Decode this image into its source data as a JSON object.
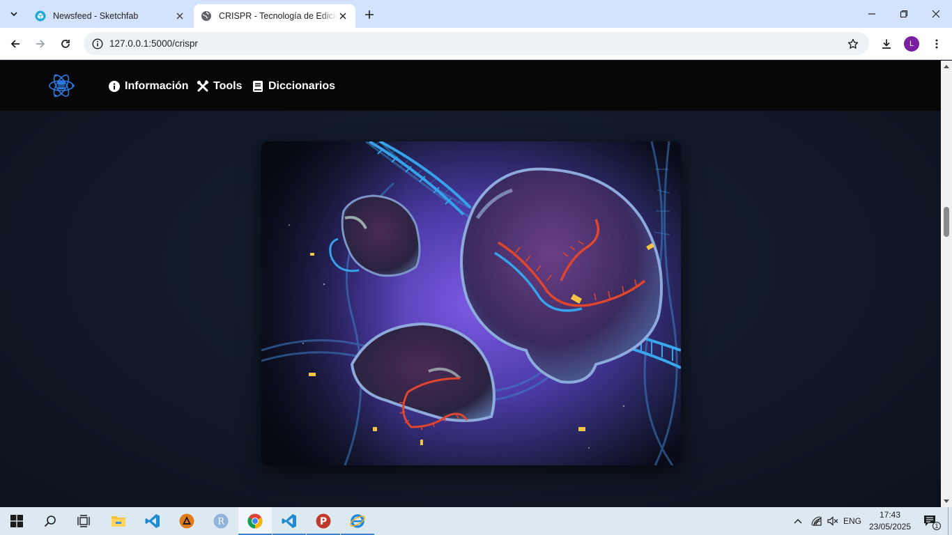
{
  "browser": {
    "tabs": [
      {
        "title": "Newsfeed - Sketchfab",
        "active": false
      },
      {
        "title": "CRISPR - Tecnología de Edición",
        "active": true
      }
    ],
    "url": "127.0.0.1:5000/crispr",
    "profile_initial": "L"
  },
  "site": {
    "nav": [
      {
        "label": "Información",
        "icon": "info-circle-icon"
      },
      {
        "label": "Tools",
        "icon": "tools-icon"
      },
      {
        "label": "Diccionarios",
        "icon": "book-icon"
      }
    ],
    "hero_image": "crispr-cas9-dna-illustration"
  },
  "taskbar": {
    "apps": [
      "start-icon",
      "search-icon",
      "task-view-icon",
      "file-explorer-icon",
      "vscode-icon",
      "app-triangle-icon",
      "r-icon",
      "chrome-icon",
      "vscode-icon",
      "p-app-icon",
      "internet-explorer-icon"
    ],
    "language": "ENG",
    "time": "17:43",
    "date": "23/05/2025",
    "notification_count": "1"
  },
  "colors": {
    "tabstrip": "#d3e3fd",
    "site_nav": "#070707",
    "page_bg": "#101826",
    "taskbar": "#dde9f1"
  }
}
